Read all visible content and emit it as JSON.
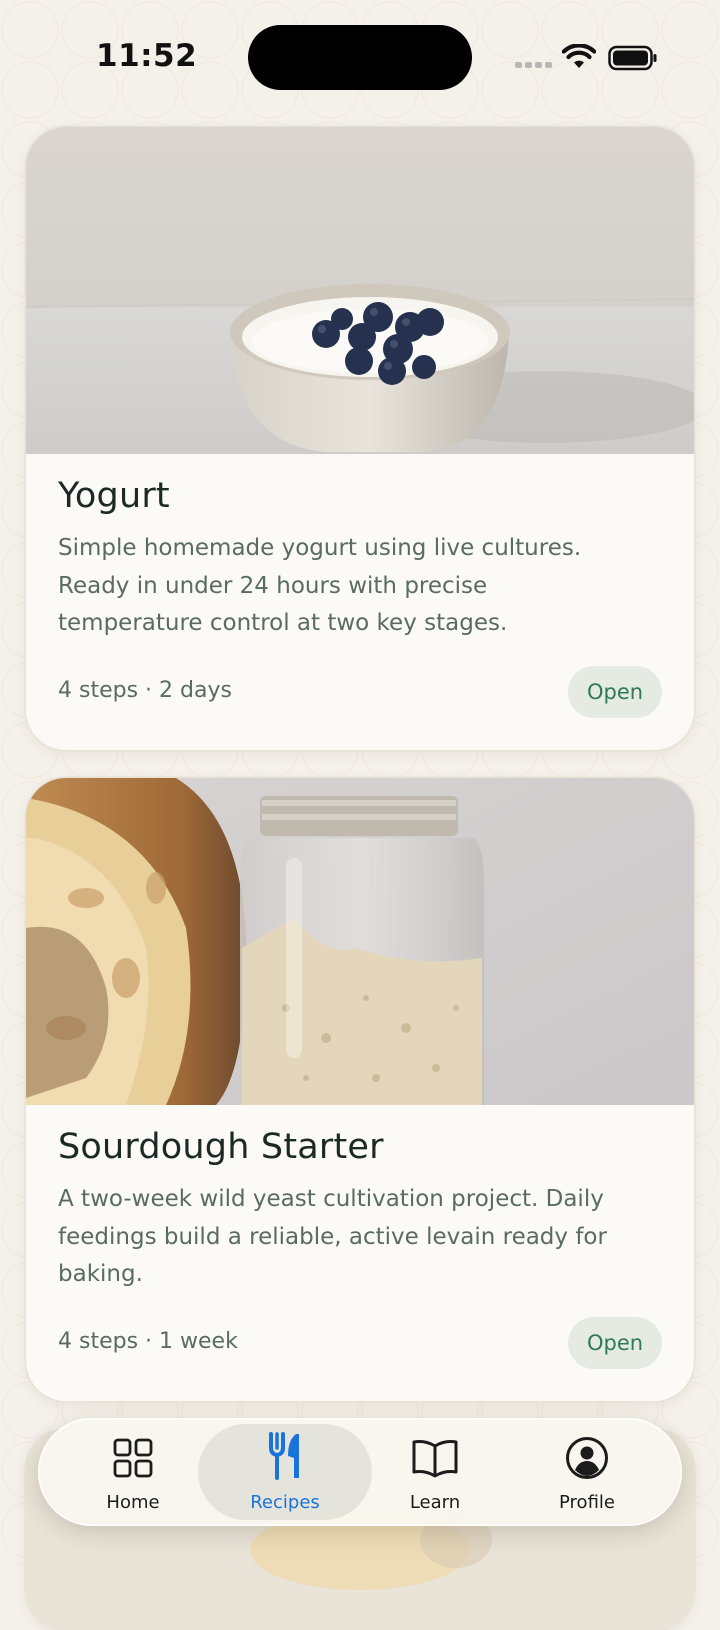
{
  "status_bar": {
    "time": "11:52"
  },
  "recipes": [
    {
      "title": "Yogurt",
      "description_lines": [
        "Simple homemade yogurt using live cultures.",
        "Ready in under 24 hours with precise",
        "temperature control at two key stages."
      ],
      "meta": "4 steps · 2 days",
      "action_label": "Open",
      "image": "yogurt-bowl-with-blueberries"
    },
    {
      "title": "Sourdough Starter",
      "description_lines": [
        "A two-week wild yeast cultivation project. Daily",
        "feedings build a reliable, active levain ready for",
        "baking."
      ],
      "meta": "4 steps · 1 week",
      "action_label": "Open",
      "image": "bread-loaf-and-starter-jar"
    }
  ],
  "tab_bar": {
    "active": "Recipes",
    "tabs": [
      {
        "label": "Home",
        "icon": "grid-icon"
      },
      {
        "label": "Recipes",
        "icon": "fork-knife-icon"
      },
      {
        "label": "Learn",
        "icon": "book-icon"
      },
      {
        "label": "Profile",
        "icon": "person-circle-icon"
      }
    ]
  },
  "colors": {
    "background": "#f4f1ea",
    "card": "#fbfaf7",
    "accent": "#1a73d9",
    "open_button_bg": "#e5ebe3",
    "open_button_text": "#2f7a52",
    "body_text": "#5a6b62"
  }
}
